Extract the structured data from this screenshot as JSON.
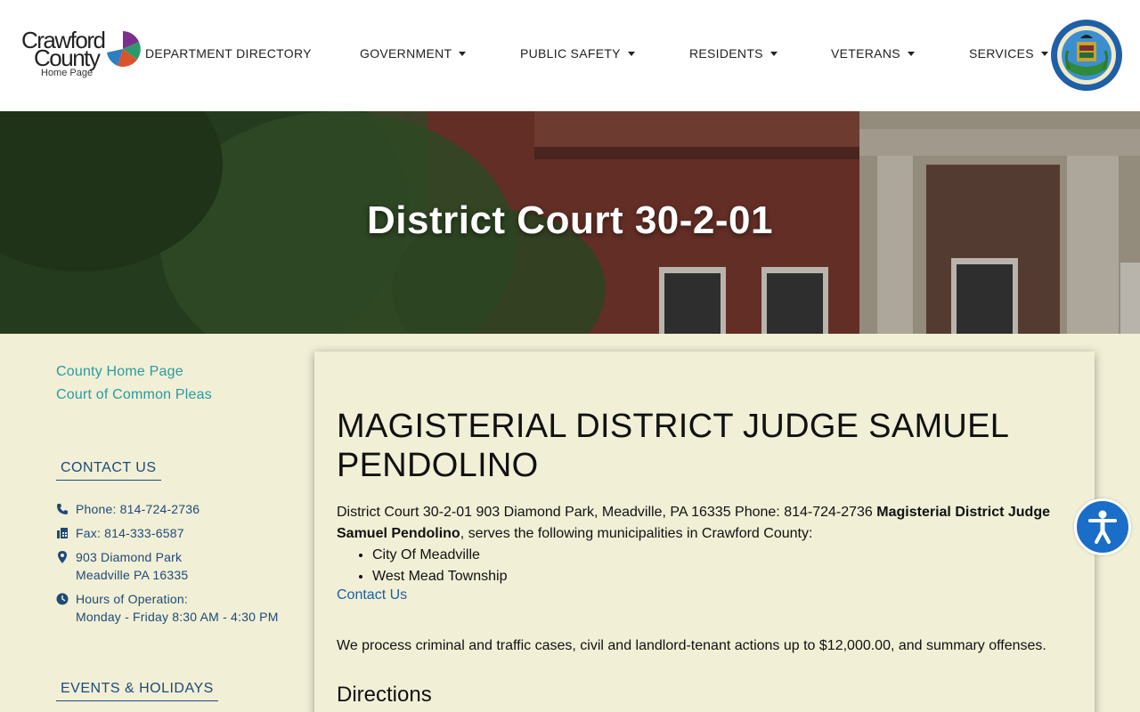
{
  "header": {
    "logo": {
      "line1": "Crawford",
      "line2": "County",
      "subtitle": "Home Page"
    },
    "nav": [
      {
        "label": "DEPARTMENT DIRECTORY",
        "has_dropdown": false
      },
      {
        "label": "GOVERNMENT",
        "has_dropdown": true
      },
      {
        "label": "PUBLIC SAFETY",
        "has_dropdown": true
      },
      {
        "label": "RESIDENTS",
        "has_dropdown": true
      },
      {
        "label": "VETERANS",
        "has_dropdown": true
      },
      {
        "label": "SERVICES",
        "has_dropdown": true
      }
    ],
    "seal_icon": "county-seal-icon"
  },
  "hero": {
    "title": "District Court 30-2-01"
  },
  "sidebar": {
    "links": [
      "County Home Page",
      "Court of Common Pleas"
    ],
    "contact_heading": "CONTACT US",
    "contact": {
      "phone": "Phone: 814-724-2736",
      "fax": "Fax: 814-333-6587",
      "address_line1": "903 Diamond Park",
      "address_line2": "Meadville PA 16335",
      "hours_label": "Hours of Operation:",
      "hours_value": "Monday - Friday 8:30 AM - 4:30 PM"
    },
    "events_heading": "EVENTS & HOLIDAYS"
  },
  "main": {
    "heading": "MAGISTERIAL DISTRICT JUDGE SAMUEL PENDOLINO",
    "intro_text": "District Court 30-2-01 903 Diamond Park, Meadville, PA 16335 Phone: 814-724-2736 ",
    "intro_bold": "Magisterial District Judge Samuel Pendolino",
    "intro_tail": ", serves the following municipalities in Crawford County:",
    "municipalities": [
      "City Of Meadville",
      "West Mead Township"
    ],
    "contact_link": "Contact Us",
    "cases_text": "We process criminal and traffic cases, civil and landlord-tenant actions up to $12,000.00, and summary offenses.",
    "directions_heading": "Directions"
  },
  "colors": {
    "page_bg": "#f1efd6",
    "sidebar_link": "#2b9aa0",
    "sidebar_text": "#1e4a7a",
    "accessibility_button": "#1a6ec8"
  },
  "icons": {
    "phone": "phone-icon",
    "fax": "fax-icon",
    "location": "map-pin-icon",
    "hours": "clock-icon",
    "accessibility": "accessibility-icon",
    "dropdown": "caret-down-icon"
  }
}
